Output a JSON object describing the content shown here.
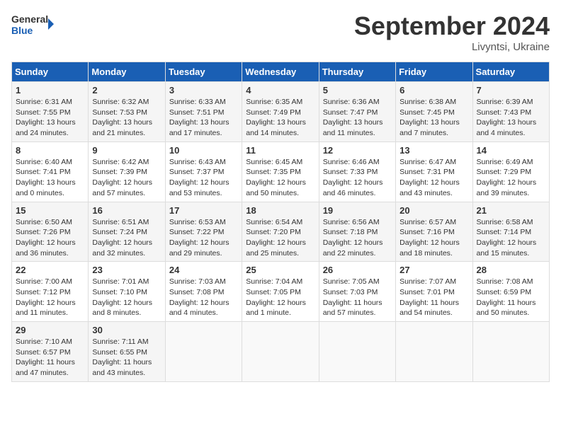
{
  "logo": {
    "line1": "General",
    "line2": "Blue"
  },
  "title": "September 2024",
  "subtitle": "Livyntsi, Ukraine",
  "days_header": [
    "Sunday",
    "Monday",
    "Tuesday",
    "Wednesday",
    "Thursday",
    "Friday",
    "Saturday"
  ],
  "weeks": [
    [
      {
        "day": "1",
        "info": "Sunrise: 6:31 AM\nSunset: 7:55 PM\nDaylight: 13 hours and 24 minutes."
      },
      {
        "day": "2",
        "info": "Sunrise: 6:32 AM\nSunset: 7:53 PM\nDaylight: 13 hours and 21 minutes."
      },
      {
        "day": "3",
        "info": "Sunrise: 6:33 AM\nSunset: 7:51 PM\nDaylight: 13 hours and 17 minutes."
      },
      {
        "day": "4",
        "info": "Sunrise: 6:35 AM\nSunset: 7:49 PM\nDaylight: 13 hours and 14 minutes."
      },
      {
        "day": "5",
        "info": "Sunrise: 6:36 AM\nSunset: 7:47 PM\nDaylight: 13 hours and 11 minutes."
      },
      {
        "day": "6",
        "info": "Sunrise: 6:38 AM\nSunset: 7:45 PM\nDaylight: 13 hours and 7 minutes."
      },
      {
        "day": "7",
        "info": "Sunrise: 6:39 AM\nSunset: 7:43 PM\nDaylight: 13 hours and 4 minutes."
      }
    ],
    [
      {
        "day": "8",
        "info": "Sunrise: 6:40 AM\nSunset: 7:41 PM\nDaylight: 13 hours and 0 minutes."
      },
      {
        "day": "9",
        "info": "Sunrise: 6:42 AM\nSunset: 7:39 PM\nDaylight: 12 hours and 57 minutes."
      },
      {
        "day": "10",
        "info": "Sunrise: 6:43 AM\nSunset: 7:37 PM\nDaylight: 12 hours and 53 minutes."
      },
      {
        "day": "11",
        "info": "Sunrise: 6:45 AM\nSunset: 7:35 PM\nDaylight: 12 hours and 50 minutes."
      },
      {
        "day": "12",
        "info": "Sunrise: 6:46 AM\nSunset: 7:33 PM\nDaylight: 12 hours and 46 minutes."
      },
      {
        "day": "13",
        "info": "Sunrise: 6:47 AM\nSunset: 7:31 PM\nDaylight: 12 hours and 43 minutes."
      },
      {
        "day": "14",
        "info": "Sunrise: 6:49 AM\nSunset: 7:29 PM\nDaylight: 12 hours and 39 minutes."
      }
    ],
    [
      {
        "day": "15",
        "info": "Sunrise: 6:50 AM\nSunset: 7:26 PM\nDaylight: 12 hours and 36 minutes."
      },
      {
        "day": "16",
        "info": "Sunrise: 6:51 AM\nSunset: 7:24 PM\nDaylight: 12 hours and 32 minutes."
      },
      {
        "day": "17",
        "info": "Sunrise: 6:53 AM\nSunset: 7:22 PM\nDaylight: 12 hours and 29 minutes."
      },
      {
        "day": "18",
        "info": "Sunrise: 6:54 AM\nSunset: 7:20 PM\nDaylight: 12 hours and 25 minutes."
      },
      {
        "day": "19",
        "info": "Sunrise: 6:56 AM\nSunset: 7:18 PM\nDaylight: 12 hours and 22 minutes."
      },
      {
        "day": "20",
        "info": "Sunrise: 6:57 AM\nSunset: 7:16 PM\nDaylight: 12 hours and 18 minutes."
      },
      {
        "day": "21",
        "info": "Sunrise: 6:58 AM\nSunset: 7:14 PM\nDaylight: 12 hours and 15 minutes."
      }
    ],
    [
      {
        "day": "22",
        "info": "Sunrise: 7:00 AM\nSunset: 7:12 PM\nDaylight: 12 hours and 11 minutes."
      },
      {
        "day": "23",
        "info": "Sunrise: 7:01 AM\nSunset: 7:10 PM\nDaylight: 12 hours and 8 minutes."
      },
      {
        "day": "24",
        "info": "Sunrise: 7:03 AM\nSunset: 7:08 PM\nDaylight: 12 hours and 4 minutes."
      },
      {
        "day": "25",
        "info": "Sunrise: 7:04 AM\nSunset: 7:05 PM\nDaylight: 12 hours and 1 minute."
      },
      {
        "day": "26",
        "info": "Sunrise: 7:05 AM\nSunset: 7:03 PM\nDaylight: 11 hours and 57 minutes."
      },
      {
        "day": "27",
        "info": "Sunrise: 7:07 AM\nSunset: 7:01 PM\nDaylight: 11 hours and 54 minutes."
      },
      {
        "day": "28",
        "info": "Sunrise: 7:08 AM\nSunset: 6:59 PM\nDaylight: 11 hours and 50 minutes."
      }
    ],
    [
      {
        "day": "29",
        "info": "Sunrise: 7:10 AM\nSunset: 6:57 PM\nDaylight: 11 hours and 47 minutes."
      },
      {
        "day": "30",
        "info": "Sunrise: 7:11 AM\nSunset: 6:55 PM\nDaylight: 11 hours and 43 minutes."
      },
      {
        "day": "",
        "info": ""
      },
      {
        "day": "",
        "info": ""
      },
      {
        "day": "",
        "info": ""
      },
      {
        "day": "",
        "info": ""
      },
      {
        "day": "",
        "info": ""
      }
    ]
  ]
}
